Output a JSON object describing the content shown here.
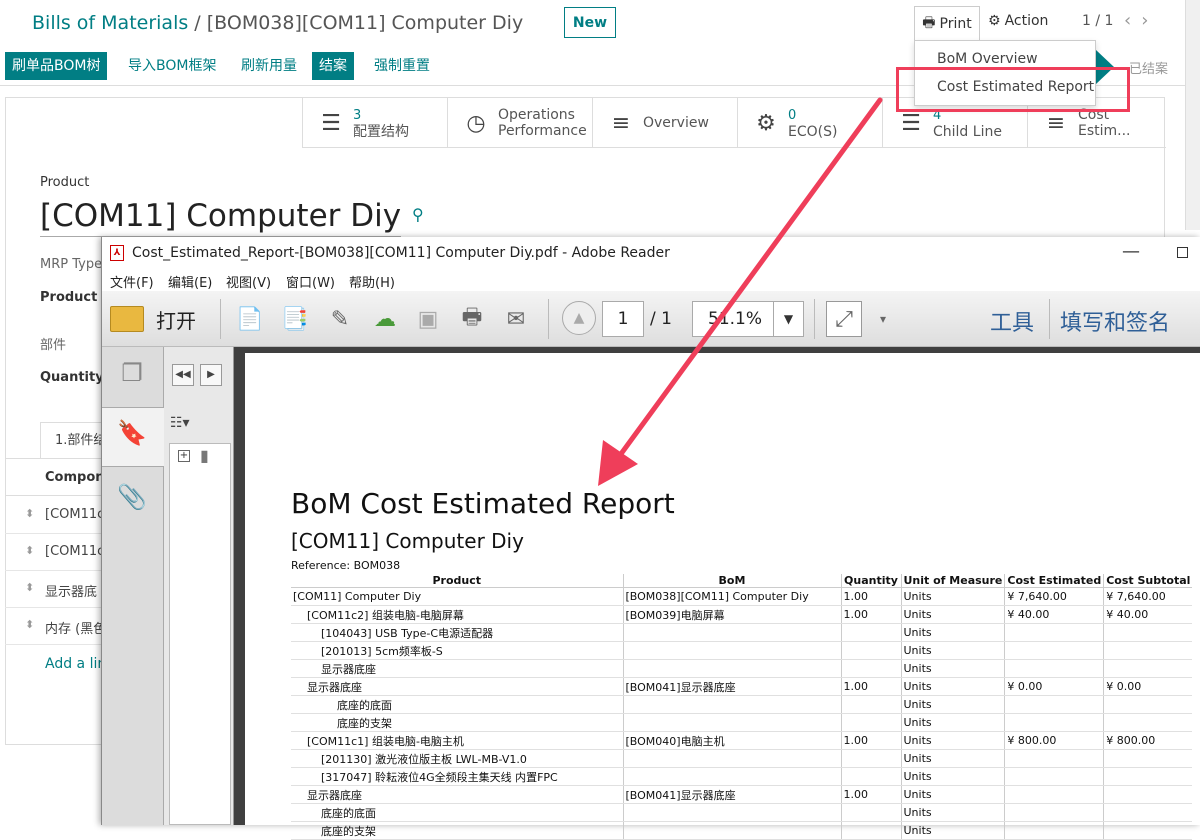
{
  "odoo": {
    "breadcrumb_root": "Bills of Materials",
    "breadcrumb_sep": "/",
    "breadcrumb_current": "[BOM038][COM11] Computer Diy",
    "new_label": "New",
    "print_label": "Print",
    "action_label": "Action",
    "pager": "1 / 1",
    "buttons": [
      "刷单品BOM树",
      "导入BOM框架",
      "刷新用量",
      "结案",
      "强制重置"
    ],
    "status_done": "已结案",
    "print_menu": [
      "BoM Overview",
      "Cost Estimated Report"
    ],
    "smart_buttons": [
      {
        "num": "3",
        "label": "配置结构",
        "icon": "list-icon"
      },
      {
        "num": "",
        "label": "Operations",
        "label2": "Performance",
        "icon": "clock-icon"
      },
      {
        "num": "",
        "label": "Overview",
        "icon": "bars-icon"
      },
      {
        "num": "0",
        "label": "ECO(S)",
        "icon": "gears-icon"
      },
      {
        "num": "4",
        "label": "Child Line",
        "icon": "list-icon"
      },
      {
        "num": "",
        "label": "Cost Estim...",
        "icon": "bars-icon"
      }
    ],
    "product_label": "Product",
    "product_value": "[COM11] Computer Diy",
    "mrp_type_label": "MRP Type",
    "product_v_label": "Product V",
    "parts_label": "部件",
    "quantity_label": "Quantity",
    "tab_label": "1.部件结",
    "table_header": "Compon",
    "rows": [
      "[COM11c",
      "[COM11c",
      "显示器底",
      "内存 (黑色"
    ],
    "add_line": "Add a lin"
  },
  "reader": {
    "title": "Cost_Estimated_Report-[BOM038][COM11] Computer Diy.pdf - Adobe Reader",
    "menu": [
      "文件(F)",
      "编辑(E)",
      "视图(V)",
      "窗口(W)",
      "帮助(H)"
    ],
    "open_label": "打开",
    "page_current": "1",
    "page_total": "/ 1",
    "zoom": "51.1%",
    "tools": "工具",
    "fill_sign": "填写和签名"
  },
  "pdf": {
    "title": "BoM Cost Estimated Report",
    "product": "[COM11] Computer Diy",
    "reference": "Reference: BOM038",
    "columns": [
      "Product",
      "BoM",
      "Quantity",
      "Unit of Measure",
      "Cost Estimated",
      "Cost Subtotal"
    ],
    "rows": [
      {
        "level": 0,
        "product": "[COM11] Computer Diy",
        "bom": "[BOM038][COM11] Computer Diy",
        "qty": "1.00",
        "uom": "Units",
        "cost": "¥ 7,640.00",
        "subtotal": "¥ 7,640.00"
      },
      {
        "level": 1,
        "product": "[COM11c2] 组装电脑-电脑屏幕",
        "bom": "[BOM039]电脑屏幕",
        "qty": "1.00",
        "uom": "Units",
        "cost": "¥ 40.00",
        "subtotal": "¥ 40.00"
      },
      {
        "level": 2,
        "product": "[104043] USB Type-C电源适配器",
        "bom": "",
        "qty": "",
        "uom": "Units",
        "cost": "",
        "subtotal": ""
      },
      {
        "level": 2,
        "product": "[201013] 5cm频率板-S",
        "bom": "",
        "qty": "",
        "uom": "Units",
        "cost": "",
        "subtotal": ""
      },
      {
        "level": 2,
        "product": "显示器底座",
        "bom": "",
        "qty": "",
        "uom": "Units",
        "cost": "",
        "subtotal": ""
      },
      {
        "level": 1,
        "product": "显示器底座",
        "bom": "[BOM041]显示器底座",
        "qty": "1.00",
        "uom": "Units",
        "cost": "¥ 0.00",
        "subtotal": "¥ 0.00"
      },
      {
        "level": 3,
        "product": "底座的底面",
        "bom": "",
        "qty": "",
        "uom": "Units",
        "cost": "",
        "subtotal": ""
      },
      {
        "level": 3,
        "product": "底座的支架",
        "bom": "",
        "qty": "",
        "uom": "Units",
        "cost": "",
        "subtotal": ""
      },
      {
        "level": 1,
        "product": "[COM11c1] 组装电脑-电脑主机",
        "bom": "[BOM040]电脑主机",
        "qty": "1.00",
        "uom": "Units",
        "cost": "¥ 800.00",
        "subtotal": "¥ 800.00"
      },
      {
        "level": 2,
        "product": "[201130] 激光液位版主板 LWL-MB-V1.0",
        "bom": "",
        "qty": "",
        "uom": "Units",
        "cost": "",
        "subtotal": ""
      },
      {
        "level": 2,
        "product": "[317047] 聆耘液位4G全频段主集天线 内置FPC",
        "bom": "",
        "qty": "",
        "uom": "Units",
        "cost": "",
        "subtotal": ""
      },
      {
        "level": 1,
        "product": "显示器底座",
        "bom": "[BOM041]显示器底座",
        "qty": "1.00",
        "uom": "Units",
        "cost": "",
        "subtotal": ""
      },
      {
        "level": 2,
        "product": "底座的底面",
        "bom": "",
        "qty": "",
        "uom": "Units",
        "cost": "",
        "subtotal": ""
      },
      {
        "level": 2,
        "product": "底座的支架",
        "bom": "",
        "qty": "",
        "uom": "Units",
        "cost": "",
        "subtotal": ""
      }
    ]
  },
  "colors": {
    "accent": "#017e84",
    "highlight": "#ef3e5a"
  }
}
